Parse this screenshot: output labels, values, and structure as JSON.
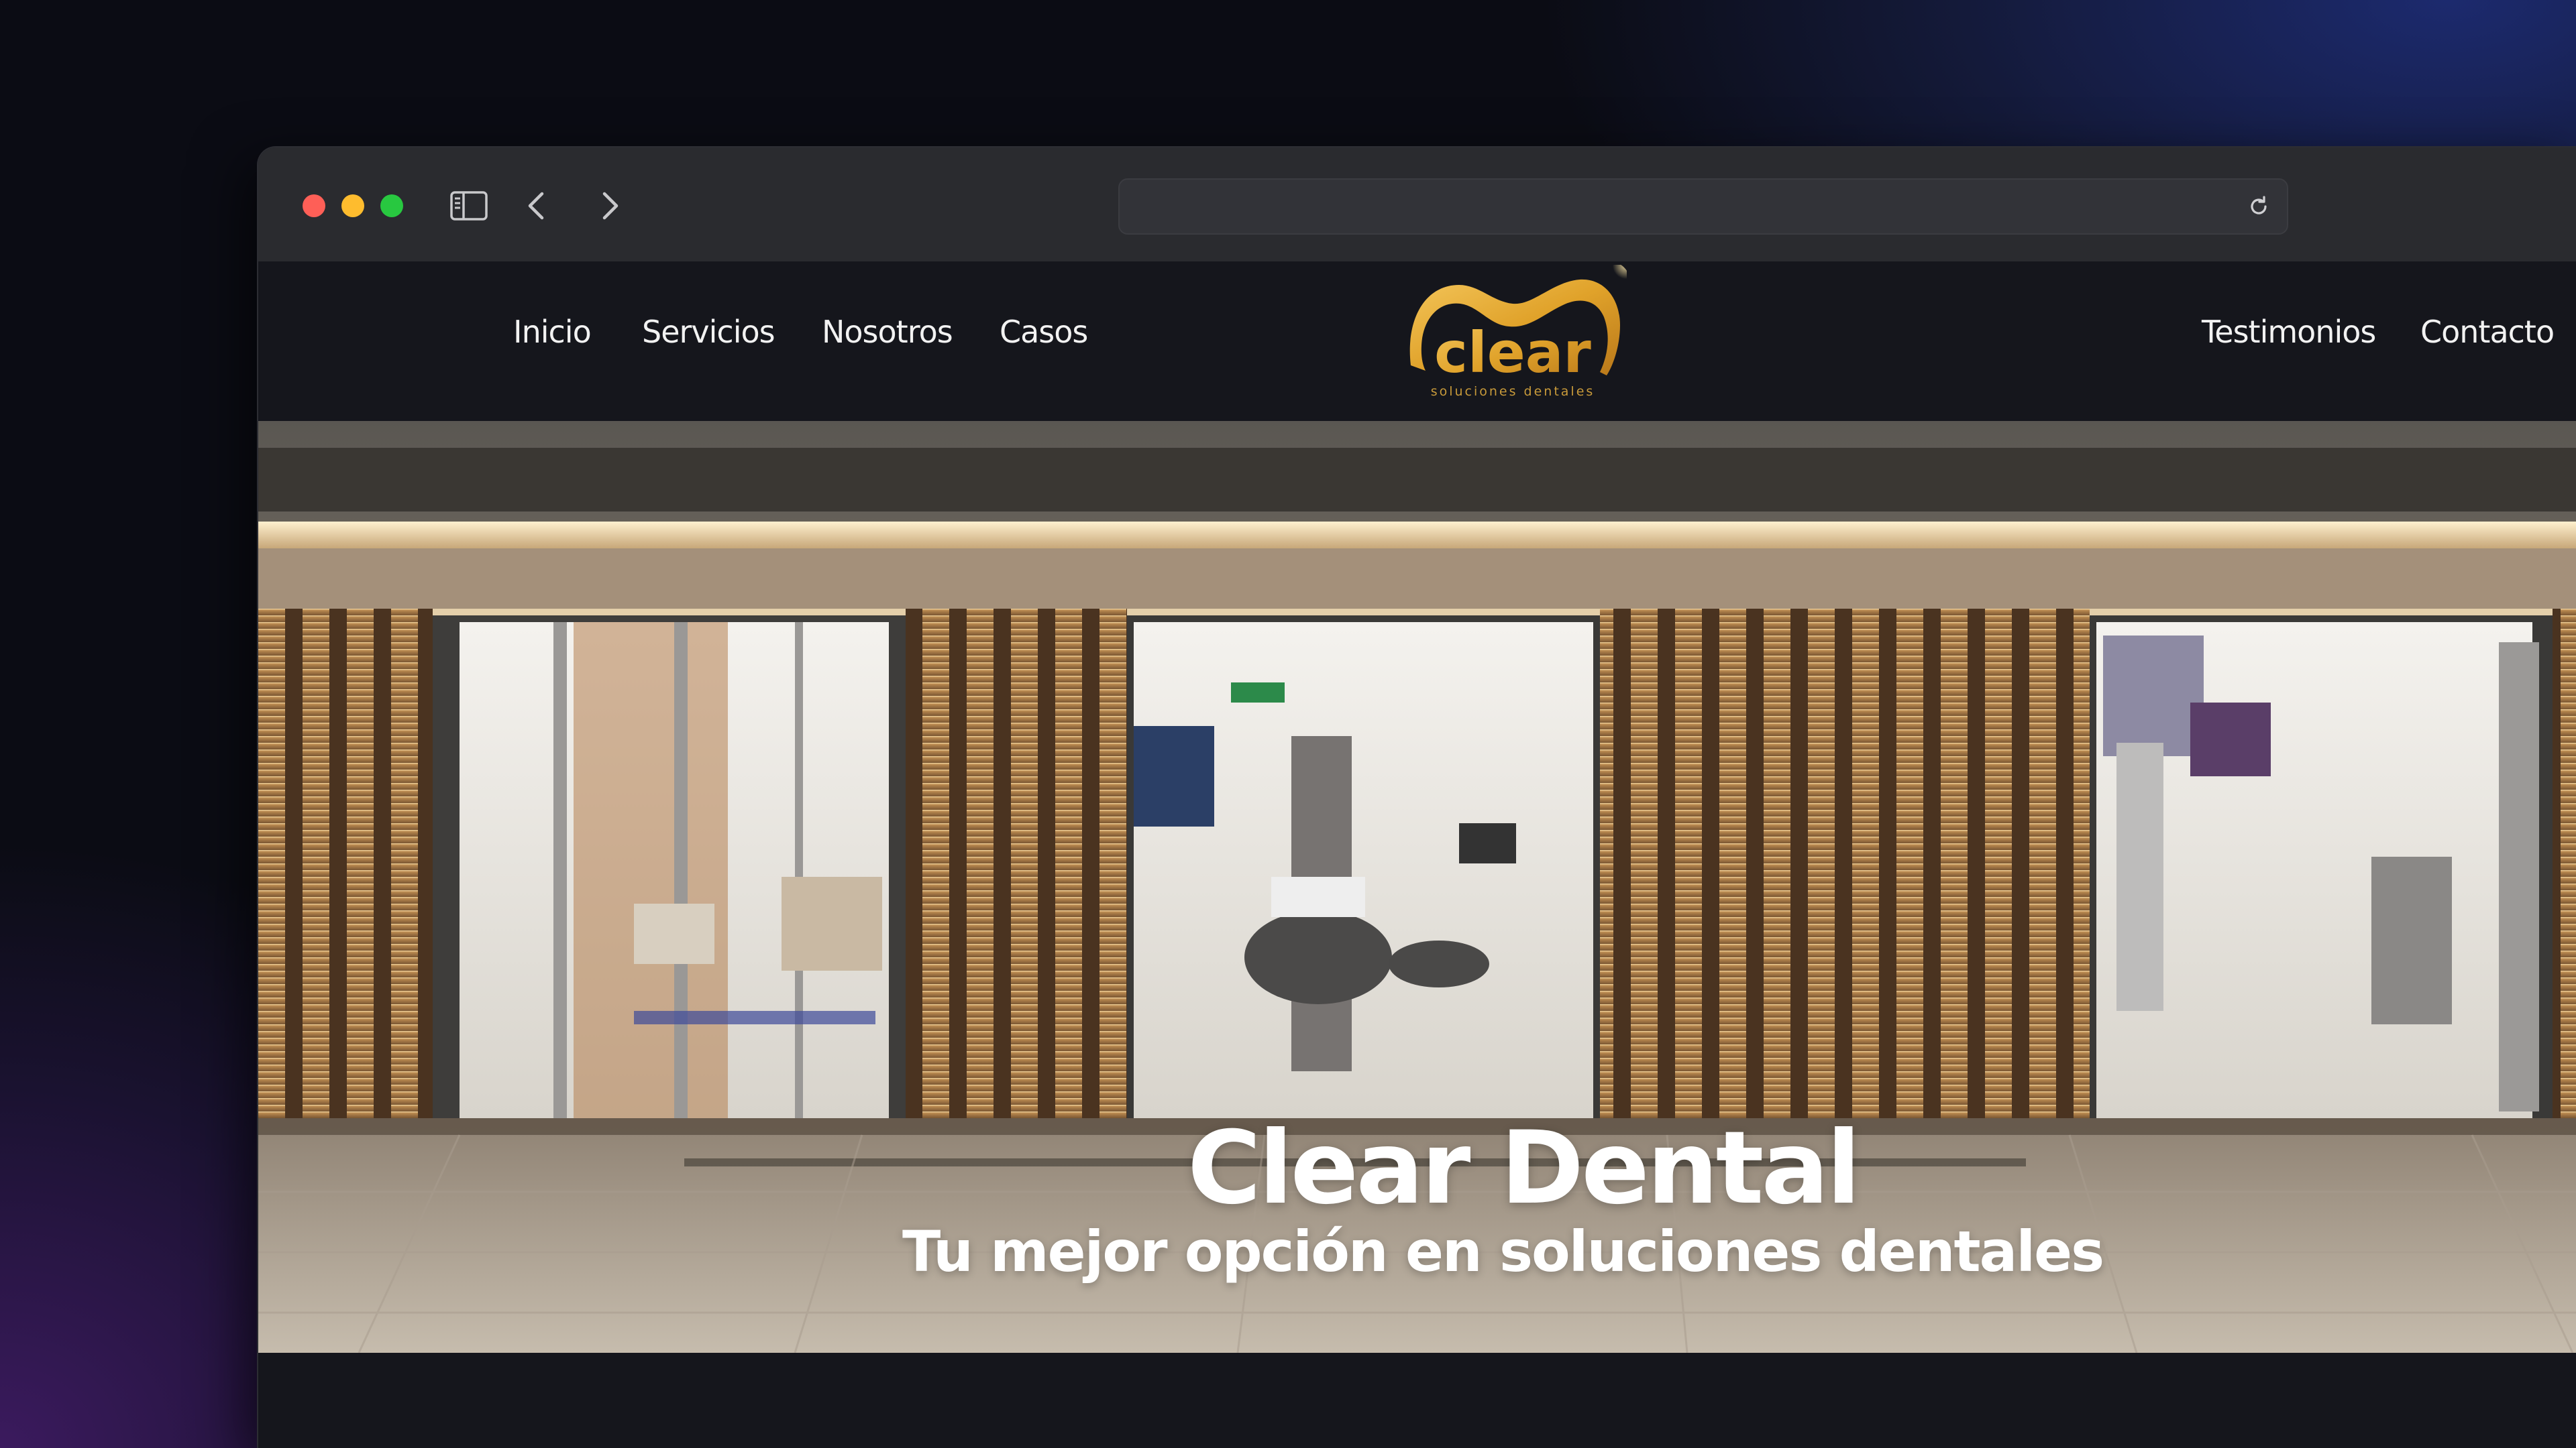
{
  "browser": {
    "address_value": "",
    "icons": [
      "sidebar-toggle-icon",
      "chevron-left-icon",
      "chevron-right-icon",
      "reload-icon"
    ]
  },
  "nav": {
    "left_links": [
      "Inicio",
      "Servicios",
      "Nosotros",
      "Casos"
    ],
    "right_links": [
      "Testimonios",
      "Contacto"
    ],
    "social_icons": [
      "facebook-icon",
      "instagram-icon"
    ]
  },
  "logo": {
    "brand": "clear",
    "tagline": "soluciones dentales"
  },
  "hero": {
    "title": "Clear Dental",
    "subtitle": "Tu mejor opción en soluciones dentales"
  },
  "colors": {
    "accent_gold": "#e0a22a",
    "nav_background": "#15161c",
    "chrome_background": "#2a2b2f"
  }
}
